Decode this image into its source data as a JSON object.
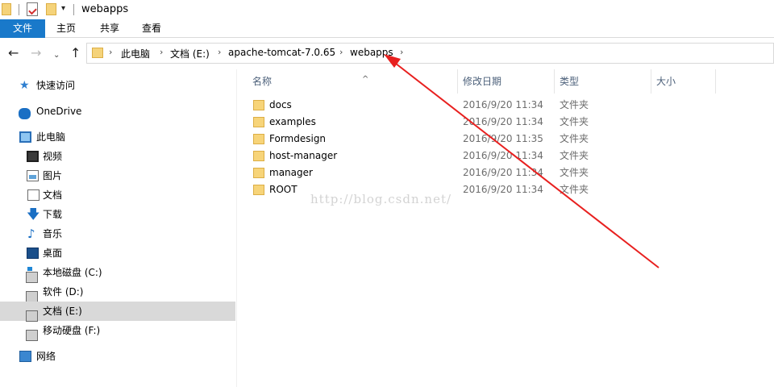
{
  "window": {
    "title": "webapps"
  },
  "ribbon": {
    "tabs": [
      "文件",
      "主页",
      "共享",
      "查看"
    ]
  },
  "address": {
    "breadcrumbs": [
      "此电脑",
      "文档 (E:)",
      "apache-tomcat-7.0.65",
      "webapps"
    ]
  },
  "nav": {
    "items": [
      {
        "label": "快速访问",
        "icon": "quick-access-star-icon"
      },
      {
        "label": "OneDrive",
        "icon": "onedrive-cloud-icon"
      },
      {
        "label": "此电脑",
        "icon": "this-pc-icon"
      },
      {
        "label": "视频",
        "icon": "video-folder-icon"
      },
      {
        "label": "图片",
        "icon": "pictures-folder-icon"
      },
      {
        "label": "文档",
        "icon": "documents-folder-icon"
      },
      {
        "label": "下载",
        "icon": "download-arrow-icon"
      },
      {
        "label": "音乐",
        "icon": "music-note-icon"
      },
      {
        "label": "桌面",
        "icon": "desktop-folder-icon"
      },
      {
        "label": "本地磁盘 (C:)",
        "icon": "system-drive-icon"
      },
      {
        "label": "软件 (D:)",
        "icon": "drive-icon"
      },
      {
        "label": "文档 (E:)",
        "icon": "drive-icon"
      },
      {
        "label": "移动硬盘 (F:)",
        "icon": "drive-icon"
      },
      {
        "label": "网络",
        "icon": "network-icon"
      }
    ],
    "selected": "文档 (E:)"
  },
  "columns": {
    "name": "名称",
    "modified": "修改日期",
    "type": "类型",
    "size": "大小"
  },
  "files": [
    {
      "name": "docs",
      "modified": "2016/9/20 11:34",
      "type": "文件夹"
    },
    {
      "name": "examples",
      "modified": "2016/9/20 11:34",
      "type": "文件夹"
    },
    {
      "name": "Formdesign",
      "modified": "2016/9/20 11:35",
      "type": "文件夹"
    },
    {
      "name": "host-manager",
      "modified": "2016/9/20 11:34",
      "type": "文件夹"
    },
    {
      "name": "manager",
      "modified": "2016/9/20 11:34",
      "type": "文件夹"
    },
    {
      "name": "ROOT",
      "modified": "2016/9/20 11:34",
      "type": "文件夹"
    }
  ],
  "watermark": "http://blog.csdn.net/",
  "colors": {
    "accent": "#1979ca",
    "selection": "#d9d9d9",
    "folder": "#f7d479",
    "annotation": "#e8201f"
  }
}
